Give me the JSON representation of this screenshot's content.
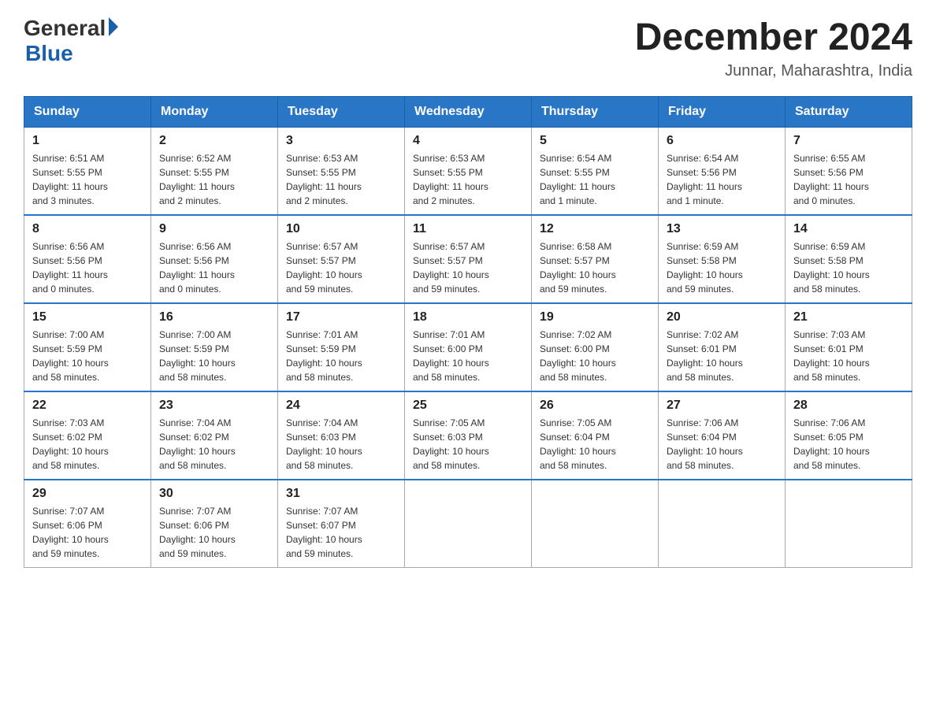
{
  "logo": {
    "general": "General",
    "blue": "Blue"
  },
  "title": "December 2024",
  "location": "Junnar, Maharashtra, India",
  "days_header": [
    "Sunday",
    "Monday",
    "Tuesday",
    "Wednesday",
    "Thursday",
    "Friday",
    "Saturday"
  ],
  "weeks": [
    [
      {
        "day": "1",
        "sunrise": "6:51 AM",
        "sunset": "5:55 PM",
        "daylight": "11 hours and 3 minutes."
      },
      {
        "day": "2",
        "sunrise": "6:52 AM",
        "sunset": "5:55 PM",
        "daylight": "11 hours and 2 minutes."
      },
      {
        "day": "3",
        "sunrise": "6:53 AM",
        "sunset": "5:55 PM",
        "daylight": "11 hours and 2 minutes."
      },
      {
        "day": "4",
        "sunrise": "6:53 AM",
        "sunset": "5:55 PM",
        "daylight": "11 hours and 2 minutes."
      },
      {
        "day": "5",
        "sunrise": "6:54 AM",
        "sunset": "5:55 PM",
        "daylight": "11 hours and 1 minute."
      },
      {
        "day": "6",
        "sunrise": "6:54 AM",
        "sunset": "5:56 PM",
        "daylight": "11 hours and 1 minute."
      },
      {
        "day": "7",
        "sunrise": "6:55 AM",
        "sunset": "5:56 PM",
        "daylight": "11 hours and 0 minutes."
      }
    ],
    [
      {
        "day": "8",
        "sunrise": "6:56 AM",
        "sunset": "5:56 PM",
        "daylight": "11 hours and 0 minutes."
      },
      {
        "day": "9",
        "sunrise": "6:56 AM",
        "sunset": "5:56 PM",
        "daylight": "11 hours and 0 minutes."
      },
      {
        "day": "10",
        "sunrise": "6:57 AM",
        "sunset": "5:57 PM",
        "daylight": "10 hours and 59 minutes."
      },
      {
        "day": "11",
        "sunrise": "6:57 AM",
        "sunset": "5:57 PM",
        "daylight": "10 hours and 59 minutes."
      },
      {
        "day": "12",
        "sunrise": "6:58 AM",
        "sunset": "5:57 PM",
        "daylight": "10 hours and 59 minutes."
      },
      {
        "day": "13",
        "sunrise": "6:59 AM",
        "sunset": "5:58 PM",
        "daylight": "10 hours and 59 minutes."
      },
      {
        "day": "14",
        "sunrise": "6:59 AM",
        "sunset": "5:58 PM",
        "daylight": "10 hours and 58 minutes."
      }
    ],
    [
      {
        "day": "15",
        "sunrise": "7:00 AM",
        "sunset": "5:59 PM",
        "daylight": "10 hours and 58 minutes."
      },
      {
        "day": "16",
        "sunrise": "7:00 AM",
        "sunset": "5:59 PM",
        "daylight": "10 hours and 58 minutes."
      },
      {
        "day": "17",
        "sunrise": "7:01 AM",
        "sunset": "5:59 PM",
        "daylight": "10 hours and 58 minutes."
      },
      {
        "day": "18",
        "sunrise": "7:01 AM",
        "sunset": "6:00 PM",
        "daylight": "10 hours and 58 minutes."
      },
      {
        "day": "19",
        "sunrise": "7:02 AM",
        "sunset": "6:00 PM",
        "daylight": "10 hours and 58 minutes."
      },
      {
        "day": "20",
        "sunrise": "7:02 AM",
        "sunset": "6:01 PM",
        "daylight": "10 hours and 58 minutes."
      },
      {
        "day": "21",
        "sunrise": "7:03 AM",
        "sunset": "6:01 PM",
        "daylight": "10 hours and 58 minutes."
      }
    ],
    [
      {
        "day": "22",
        "sunrise": "7:03 AM",
        "sunset": "6:02 PM",
        "daylight": "10 hours and 58 minutes."
      },
      {
        "day": "23",
        "sunrise": "7:04 AM",
        "sunset": "6:02 PM",
        "daylight": "10 hours and 58 minutes."
      },
      {
        "day": "24",
        "sunrise": "7:04 AM",
        "sunset": "6:03 PM",
        "daylight": "10 hours and 58 minutes."
      },
      {
        "day": "25",
        "sunrise": "7:05 AM",
        "sunset": "6:03 PM",
        "daylight": "10 hours and 58 minutes."
      },
      {
        "day": "26",
        "sunrise": "7:05 AM",
        "sunset": "6:04 PM",
        "daylight": "10 hours and 58 minutes."
      },
      {
        "day": "27",
        "sunrise": "7:06 AM",
        "sunset": "6:04 PM",
        "daylight": "10 hours and 58 minutes."
      },
      {
        "day": "28",
        "sunrise": "7:06 AM",
        "sunset": "6:05 PM",
        "daylight": "10 hours and 58 minutes."
      }
    ],
    [
      {
        "day": "29",
        "sunrise": "7:07 AM",
        "sunset": "6:06 PM",
        "daylight": "10 hours and 59 minutes."
      },
      {
        "day": "30",
        "sunrise": "7:07 AM",
        "sunset": "6:06 PM",
        "daylight": "10 hours and 59 minutes."
      },
      {
        "day": "31",
        "sunrise": "7:07 AM",
        "sunset": "6:07 PM",
        "daylight": "10 hours and 59 minutes."
      },
      null,
      null,
      null,
      null
    ]
  ],
  "labels": {
    "sunrise": "Sunrise:",
    "sunset": "Sunset:",
    "daylight": "Daylight:"
  }
}
